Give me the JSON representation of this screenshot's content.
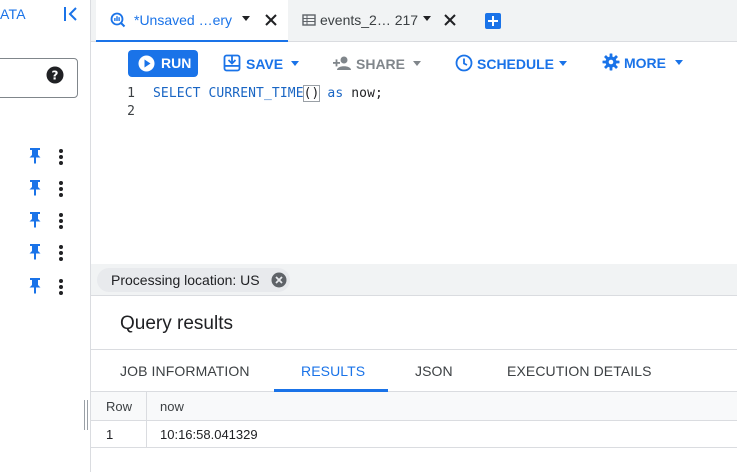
{
  "sidebar": {
    "title": "ATA",
    "collapse_icon": "collapse-left-icon",
    "help_icon": "help-icon",
    "pinned_rows": 5
  },
  "tabs": [
    {
      "label": "*Unsaved …ery",
      "icon": "query-icon",
      "active": true
    },
    {
      "label": "events_2… 217",
      "icon": "table-icon",
      "active": false
    }
  ],
  "toolbar": {
    "run": "RUN",
    "save": "SAVE",
    "share": "SHARE",
    "schedule": "SCHEDULE",
    "more": "MORE"
  },
  "editor": {
    "line_numbers": [
      "1",
      "2"
    ],
    "tokens": {
      "select": "SELECT",
      "func": "CURRENT_TIME",
      "parens": "()",
      "as": "as",
      "alias": "now;"
    }
  },
  "processing": {
    "label": "Processing location: US"
  },
  "results": {
    "title": "Query results",
    "tabs": [
      "JOB INFORMATION",
      "RESULTS",
      "JSON",
      "EXECUTION DETAILS"
    ],
    "active_tab": "RESULTS",
    "columns": [
      "Row",
      "now"
    ],
    "rows": [
      [
        "1",
        "10:16:58.041329"
      ]
    ]
  },
  "colors": {
    "accent": "#1a73e8",
    "tab_strip": "#f1f3f4",
    "pin": "#1a73e8"
  }
}
